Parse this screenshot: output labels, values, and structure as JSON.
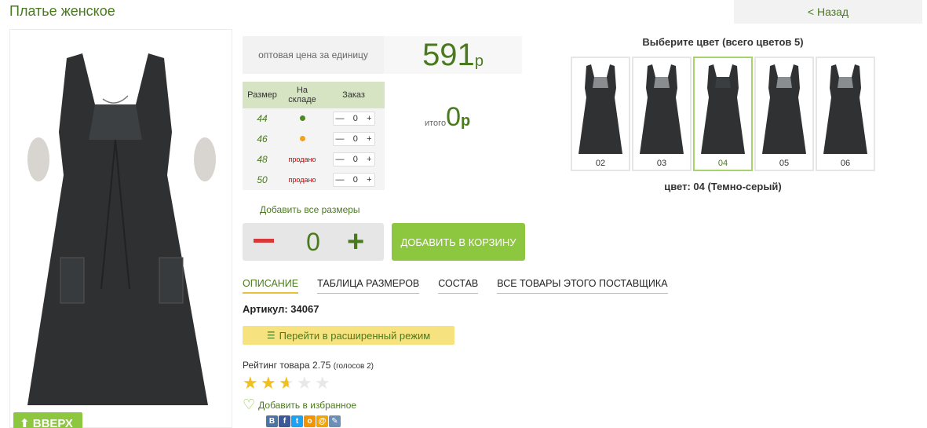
{
  "page": {
    "title": "Платье женское",
    "back_label": "< Назад",
    "up_label": "⬆ ВВЕРХ"
  },
  "price": {
    "label": "оптовая цена за единицу",
    "value": "591",
    "currency": "р"
  },
  "size_table": {
    "headers": [
      "Размер",
      "На складе",
      "Заказ"
    ],
    "rows": [
      {
        "size": "44",
        "stock": "dot",
        "stock_color": "#4a8a1e",
        "qty": "0"
      },
      {
        "size": "46",
        "stock": "dot",
        "stock_color": "#f5a11b",
        "qty": "0"
      },
      {
        "size": "48",
        "stock": "продано",
        "qty": "0"
      },
      {
        "size": "50",
        "stock": "продано",
        "qty": "0"
      }
    ],
    "minus": "—",
    "plus": "+"
  },
  "total": {
    "label": "итого",
    "value": "0",
    "currency": "р"
  },
  "add_all_label": "Добавить все размеры",
  "order": {
    "qty": "0",
    "cart_label": "ДОБАВИТЬ В КОРЗИНУ"
  },
  "tabs": [
    "ОПИСАНИЕ",
    "ТАБЛИЦА РАЗМЕРОВ",
    "СОСТАВ",
    "ВСЕ ТОВАРЫ ЭТОГО ПОСТАВЩИКА"
  ],
  "sku_label": "Артикул: 34067",
  "extended_mode_label": "Перейти в расширенный режим",
  "rating": {
    "label": "Рейтинг товара 2.75",
    "votes": "(голосов 2)",
    "value": 2.75,
    "max": 5
  },
  "favorite_label": "Добавить в избранное",
  "social": [
    "vk-icon",
    "facebook-icon",
    "twitter-icon",
    "odnoklassniki-icon",
    "mailru-icon",
    "livejournal-icon"
  ],
  "colors": {
    "title": "Выберите цвет (всего цветов 5)",
    "items": [
      "02",
      "03",
      "04",
      "05",
      "06"
    ],
    "selected_index": 2,
    "selected_label": "цвет: 04 (Темно-серый)"
  },
  "accent": {
    "green": "#8dc63f",
    "dark_green": "#4a7a1e",
    "yellow": "#f6e27e",
    "red": "#d9383a"
  }
}
